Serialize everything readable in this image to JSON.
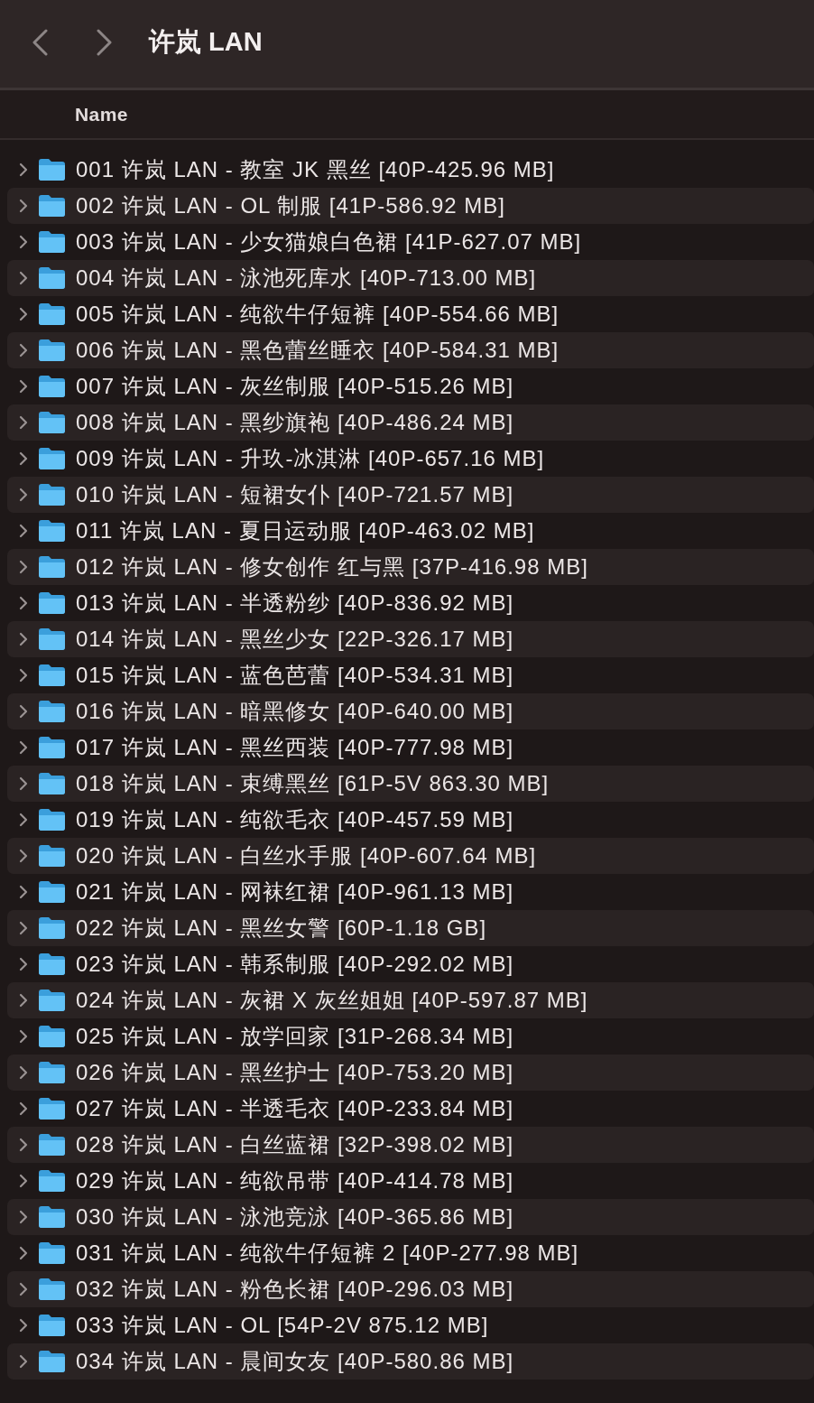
{
  "window": {
    "title": "许岚 LAN"
  },
  "columns": [
    {
      "label": "Name"
    }
  ],
  "rows": [
    {
      "name": "001 许岚 LAN - 教室 JK 黑丝 [40P-425.96 MB]",
      "expanded": false
    },
    {
      "name": "002 许岚 LAN - OL 制服 [41P-586.92 MB]",
      "expanded": false
    },
    {
      "name": "003 许岚 LAN - 少女猫娘白色裙 [41P-627.07 MB]",
      "expanded": false
    },
    {
      "name": "004 许岚 LAN - 泳池死库水 [40P-713.00 MB]",
      "expanded": false
    },
    {
      "name": "005 许岚 LAN - 纯欲牛仔短裤 [40P-554.66 MB]",
      "expanded": false
    },
    {
      "name": "006 许岚 LAN - 黑色蕾丝睡衣 [40P-584.31 MB]",
      "expanded": false
    },
    {
      "name": "007 许岚 LAN - 灰丝制服 [40P-515.26 MB]",
      "expanded": false
    },
    {
      "name": "008 许岚 LAN - 黑纱旗袍 [40P-486.24 MB]",
      "expanded": false
    },
    {
      "name": "009 许岚 LAN - 升玖-冰淇淋 [40P-657.16 MB]",
      "expanded": false
    },
    {
      "name": "010 许岚 LAN - 短裙女仆 [40P-721.57 MB]",
      "expanded": false
    },
    {
      "name": "011 许岚 LAN - 夏日运动服 [40P-463.02 MB]",
      "expanded": false
    },
    {
      "name": "012 许岚 LAN - 修女创作 红与黑 [37P-416.98 MB]",
      "expanded": false
    },
    {
      "name": "013 许岚 LAN - 半透粉纱 [40P-836.92 MB]",
      "expanded": false
    },
    {
      "name": "014 许岚 LAN - 黑丝少女 [22P-326.17 MB]",
      "expanded": false
    },
    {
      "name": "015 许岚 LAN - 蓝色芭蕾 [40P-534.31 MB]",
      "expanded": false
    },
    {
      "name": "016 许岚 LAN - 暗黑修女 [40P-640.00 MB]",
      "expanded": false
    },
    {
      "name": "017 许岚 LAN - 黑丝西装 [40P-777.98 MB]",
      "expanded": false
    },
    {
      "name": "018 许岚 LAN - 束缚黑丝 [61P-5V 863.30 MB]",
      "expanded": false
    },
    {
      "name": "019 许岚 LAN - 纯欲毛衣 [40P-457.59 MB]",
      "expanded": false
    },
    {
      "name": "020 许岚 LAN - 白丝水手服 [40P-607.64 MB]",
      "expanded": false
    },
    {
      "name": "021 许岚 LAN - 网袜红裙 [40P-961.13 MB]",
      "expanded": false
    },
    {
      "name": "022 许岚 LAN - 黑丝女警 [60P-1.18 GB]",
      "expanded": false
    },
    {
      "name": "023 许岚 LAN - 韩系制服 [40P-292.02 MB]",
      "expanded": false
    },
    {
      "name": "024 许岚 LAN - 灰裙 X 灰丝姐姐 [40P-597.87 MB]",
      "expanded": false
    },
    {
      "name": "025 许岚 LAN - 放学回家 [31P-268.34 MB]",
      "expanded": false
    },
    {
      "name": "026 许岚 LAN - 黑丝护士 [40P-753.20 MB]",
      "expanded": false
    },
    {
      "name": "027 许岚 LAN - 半透毛衣 [40P-233.84 MB]",
      "expanded": false
    },
    {
      "name": "028 许岚 LAN - 白丝蓝裙 [32P-398.02 MB]",
      "expanded": false
    },
    {
      "name": "029 许岚 LAN - 纯欲吊带 [40P-414.78 MB]",
      "expanded": false
    },
    {
      "name": "030 许岚 LAN - 泳池竞泳 [40P-365.86 MB]",
      "expanded": false
    },
    {
      "name": "031 许岚 LAN - 纯欲牛仔短裤 2 [40P-277.98 MB]",
      "expanded": false
    },
    {
      "name": "032 许岚 LAN - 粉色长裙 [40P-296.03 MB]",
      "expanded": false
    },
    {
      "name": "033 许岚 LAN - OL [54P-2V 875.12 MB]",
      "expanded": false
    },
    {
      "name": "034 许岚 LAN - 晨间女友 [40P-580.86 MB]",
      "expanded": false
    }
  ]
}
